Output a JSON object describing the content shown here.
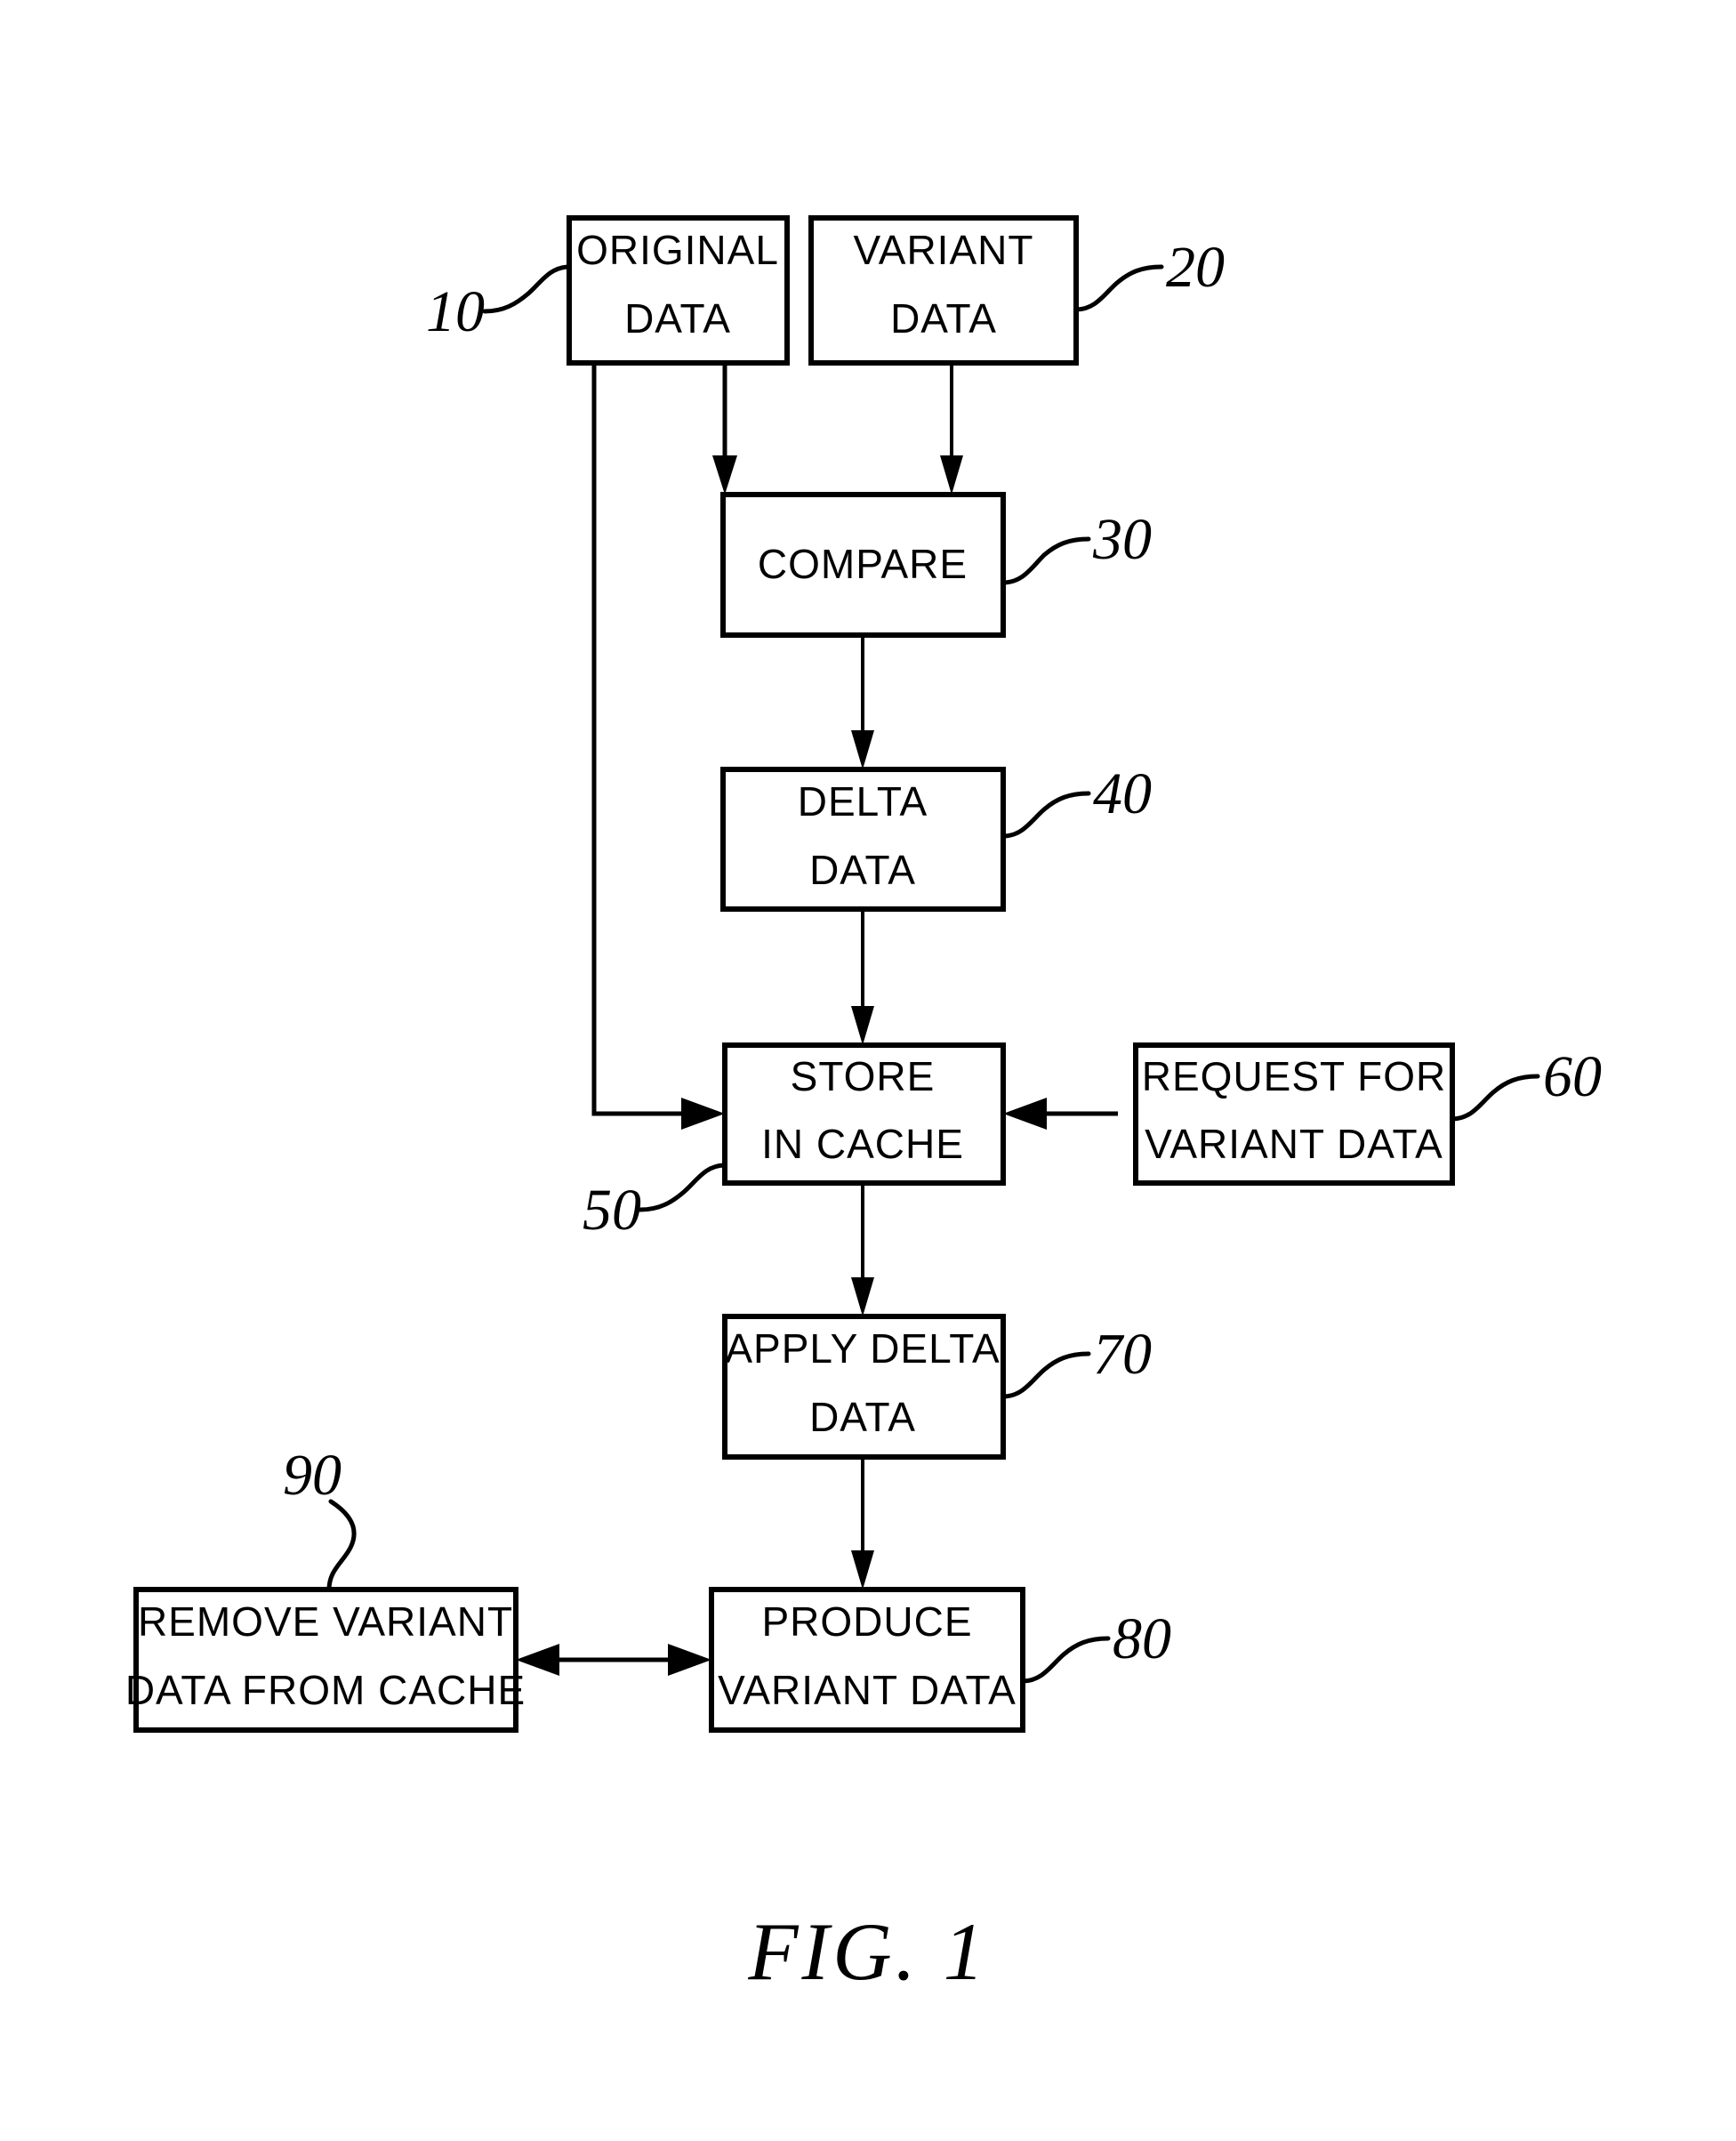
{
  "figure": {
    "caption": "FIG. 1",
    "type": "patent-flow-diagram",
    "background_color": "#ffffff",
    "line_color": "#000000"
  },
  "boxes": [
    {
      "id": "original-data",
      "ref": "10",
      "lines": [
        "ORIGINAL",
        "DATA"
      ],
      "line1": "ORIGINAL",
      "line2": "DATA"
    },
    {
      "id": "variant-data",
      "ref": "20",
      "lines": [
        "VARIANT",
        "DATA"
      ],
      "line1": "VARIANT",
      "line2": "DATA"
    },
    {
      "id": "compare",
      "ref": "30",
      "lines": [
        "COMPARE"
      ],
      "line1": "COMPARE",
      "line2": ""
    },
    {
      "id": "delta-data",
      "ref": "40",
      "lines": [
        "DELTA",
        "DATA"
      ],
      "line1": "DELTA",
      "line2": "DATA"
    },
    {
      "id": "store-in-cache",
      "ref": "50",
      "lines": [
        "STORE",
        "IN CACHE"
      ],
      "line1": "STORE",
      "line2": "IN CACHE"
    },
    {
      "id": "request-for-variant-data",
      "ref": "60",
      "lines": [
        "REQUEST FOR",
        "VARIANT DATA"
      ],
      "line1": "REQUEST FOR",
      "line2": "VARIANT DATA"
    },
    {
      "id": "apply-delta-data",
      "ref": "70",
      "lines": [
        "APPLY DELTA",
        "DATA"
      ],
      "line1": "APPLY DELTA",
      "line2": "DATA"
    },
    {
      "id": "produce-variant-data",
      "ref": "80",
      "lines": [
        "PRODUCE",
        "VARIANT DATA"
      ],
      "line1": "PRODUCE",
      "line2": "VARIANT DATA"
    },
    {
      "id": "remove-variant-data-from-cache",
      "ref": "90",
      "lines": [
        "REMOVE VARIANT",
        "DATA FROM CACHE"
      ],
      "line1": "REMOVE VARIANT",
      "line2": "DATA FROM CACHE"
    }
  ],
  "reference_numerals": {
    "original_data": "10",
    "variant_data": "20",
    "compare": "30",
    "delta_data": "40",
    "store_in_cache": "50",
    "request_for_variant_data": "60",
    "apply_delta_data": "70",
    "produce_variant_data": "80",
    "remove_variant_data_from_cache": "90"
  },
  "connections": [
    {
      "from": "original-data",
      "to": "compare",
      "style": "arrow-down"
    },
    {
      "from": "variant-data",
      "to": "compare",
      "style": "arrow-down"
    },
    {
      "from": "compare",
      "to": "delta-data",
      "style": "arrow-down"
    },
    {
      "from": "delta-data",
      "to": "store-in-cache",
      "style": "arrow-down"
    },
    {
      "from": "original-data",
      "to": "store-in-cache",
      "style": "elbow-arrow-right"
    },
    {
      "from": "request-for-variant-data",
      "to": "store-in-cache",
      "style": "arrow-left"
    },
    {
      "from": "store-in-cache",
      "to": "apply-delta-data",
      "style": "arrow-down"
    },
    {
      "from": "apply-delta-data",
      "to": "produce-variant-data",
      "style": "arrow-down"
    },
    {
      "from": "produce-variant-data",
      "to": "remove-variant-data-from-cache",
      "style": "double-arrow-horizontal"
    }
  ]
}
